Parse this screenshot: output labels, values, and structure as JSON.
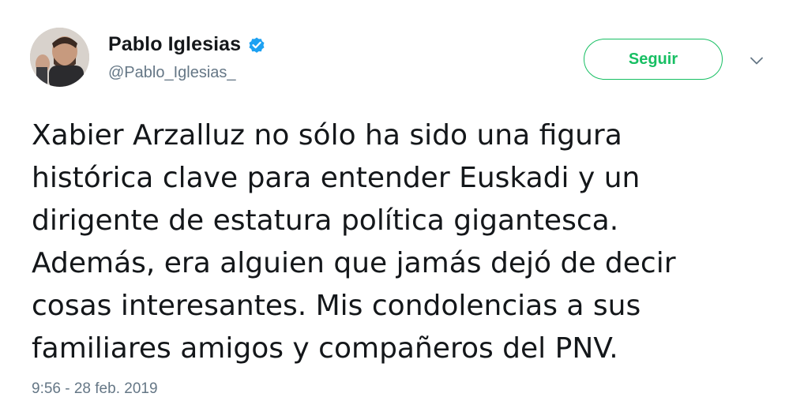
{
  "author": {
    "display_name": "Pablo Iglesias",
    "handle": "@Pablo_Iglesias_",
    "verified": true
  },
  "actions": {
    "follow_label": "Seguir",
    "menu_icon": "chevron-down-icon"
  },
  "tweet": {
    "lines": [
      "Xabier Arzalluz no sólo ha sido una figura",
      "histórica clave para entender Euskadi y un",
      "dirigente de estatura política gigantesca.",
      "Además, era alguien que jamás dejó de decir",
      "cosas interesantes. Mis condolencias a sus",
      "familiares amigos y compañeros del PNV."
    ],
    "timestamp": "9:56 - 28 feb. 2019"
  },
  "colors": {
    "follow_accent": "#17bf63",
    "verified_blue": "#1da1f2",
    "secondary_text": "#657786",
    "primary_text": "#14171a"
  }
}
